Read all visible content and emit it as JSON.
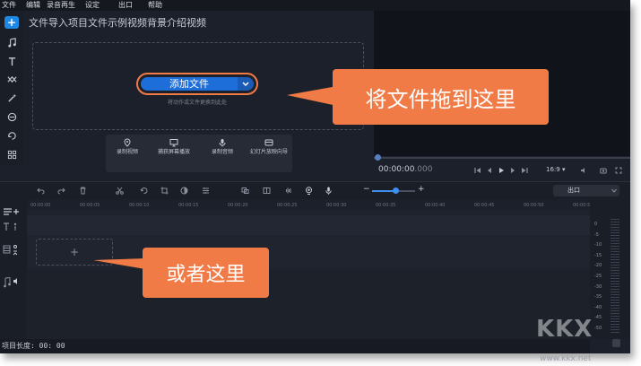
{
  "menu": [
    "文件",
    "编辑",
    "录音再生",
    "设定",
    "出口",
    "帮助"
  ],
  "import_panel": {
    "title": "文件导入项目文件示例视频背景介绍视频",
    "add_file_label": "添加文件",
    "drop_hint": "将动作或文件更换到此处",
    "options": [
      "录制视频",
      "捕获屏幕播放",
      "录制音频",
      "幻灯片放映向导"
    ]
  },
  "preview": {
    "timecode_main": "00:00:00",
    "timecode_ms": ".000",
    "aspect_ratio": "16:9"
  },
  "timeline": {
    "export_label": "出口",
    "zoom_minus": "−",
    "zoom_plus": "+",
    "zoom_level": 0.55,
    "ruler_ticks": [
      "00:00:00",
      "00:00:05",
      "00:00:10",
      "00:00:15",
      "00:00:20",
      "00:00:25",
      "00:00:30",
      "00:00:35",
      "00:00:40",
      "00:00:45",
      "00:00:50",
      "00:00:55"
    ],
    "video_drop_plus": "+",
    "vu_scale": [
      "0",
      "-5",
      "-10",
      "-15",
      "-20",
      "-25",
      "-30",
      "-35",
      "-40",
      "-45",
      "-50"
    ]
  },
  "status": {
    "project_length": "项目长度: 00: 00"
  },
  "callouts": {
    "drag_here": "将文件拖到这里",
    "or_here": "或者这里"
  },
  "watermark": {
    "logo": "KKX",
    "url": "www.kkx.net"
  },
  "colors": {
    "background": "#1c202a",
    "accent_blue": "#1d6ed8",
    "callout_orange": "#f07b47"
  }
}
